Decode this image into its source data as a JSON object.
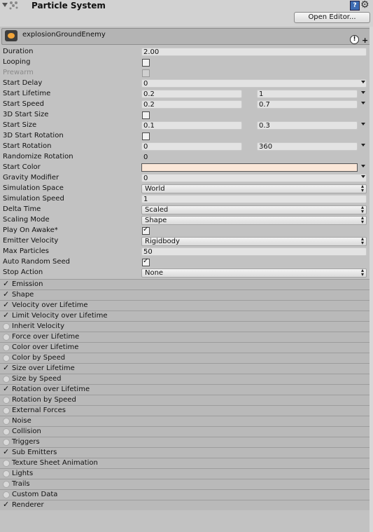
{
  "header": {
    "title": "Particle System",
    "open_editor_label": "Open Editor..."
  },
  "system": {
    "name": "explosionGroundEnemy"
  },
  "properties": {
    "duration": {
      "label": "Duration",
      "value": "2.00"
    },
    "looping": {
      "label": "Looping",
      "checked": false
    },
    "prewarm": {
      "label": "Prewarm",
      "checked": false
    },
    "start_delay": {
      "label": "Start Delay",
      "value": "0"
    },
    "start_lifetime": {
      "label": "Start Lifetime",
      "min": "0.2",
      "max": "1"
    },
    "start_speed": {
      "label": "Start Speed",
      "min": "0.2",
      "max": "0.7"
    },
    "start_size_3d": {
      "label": "3D Start Size",
      "checked": false
    },
    "start_size": {
      "label": "Start Size",
      "min": "0.1",
      "max": "0.3"
    },
    "start_rotation_3d": {
      "label": "3D Start Rotation",
      "checked": false
    },
    "start_rotation": {
      "label": "Start Rotation",
      "min": "0",
      "max": "360"
    },
    "randomize_rotation": {
      "label": "Randomize Rotation",
      "value": "0"
    },
    "start_color": {
      "label": "Start Color",
      "color": "#fbe7d8"
    },
    "gravity_modifier": {
      "label": "Gravity Modifier",
      "value": "0"
    },
    "simulation_space": {
      "label": "Simulation Space",
      "value": "World"
    },
    "simulation_speed": {
      "label": "Simulation Speed",
      "value": "1"
    },
    "delta_time": {
      "label": "Delta Time",
      "value": "Scaled"
    },
    "scaling_mode": {
      "label": "Scaling Mode",
      "value": "Shape"
    },
    "play_on_awake": {
      "label": "Play On Awake*",
      "checked": true
    },
    "emitter_velocity": {
      "label": "Emitter Velocity",
      "value": "Rigidbody"
    },
    "max_particles": {
      "label": "Max Particles",
      "value": "50"
    },
    "auto_random_seed": {
      "label": "Auto Random Seed",
      "checked": true
    },
    "stop_action": {
      "label": "Stop Action",
      "value": "None"
    }
  },
  "modules": [
    {
      "label": "Emission",
      "enabled": true
    },
    {
      "label": "Shape",
      "enabled": true
    },
    {
      "label": "Velocity over Lifetime",
      "enabled": true
    },
    {
      "label": "Limit Velocity over Lifetime",
      "enabled": true
    },
    {
      "label": "Inherit Velocity",
      "enabled": false
    },
    {
      "label": "Force over Lifetime",
      "enabled": false
    },
    {
      "label": "Color over Lifetime",
      "enabled": false
    },
    {
      "label": "Color by Speed",
      "enabled": false
    },
    {
      "label": "Size over Lifetime",
      "enabled": true
    },
    {
      "label": "Size by Speed",
      "enabled": false
    },
    {
      "label": "Rotation over Lifetime",
      "enabled": true
    },
    {
      "label": "Rotation by Speed",
      "enabled": false
    },
    {
      "label": "External Forces",
      "enabled": false
    },
    {
      "label": "Noise",
      "enabled": false
    },
    {
      "label": "Collision",
      "enabled": false
    },
    {
      "label": "Triggers",
      "enabled": false
    },
    {
      "label": "Sub Emitters",
      "enabled": true
    },
    {
      "label": "Texture Sheet Animation",
      "enabled": false
    },
    {
      "label": "Lights",
      "enabled": false
    },
    {
      "label": "Trails",
      "enabled": false
    },
    {
      "label": "Custom Data",
      "enabled": false
    },
    {
      "label": "Renderer",
      "enabled": true
    }
  ]
}
